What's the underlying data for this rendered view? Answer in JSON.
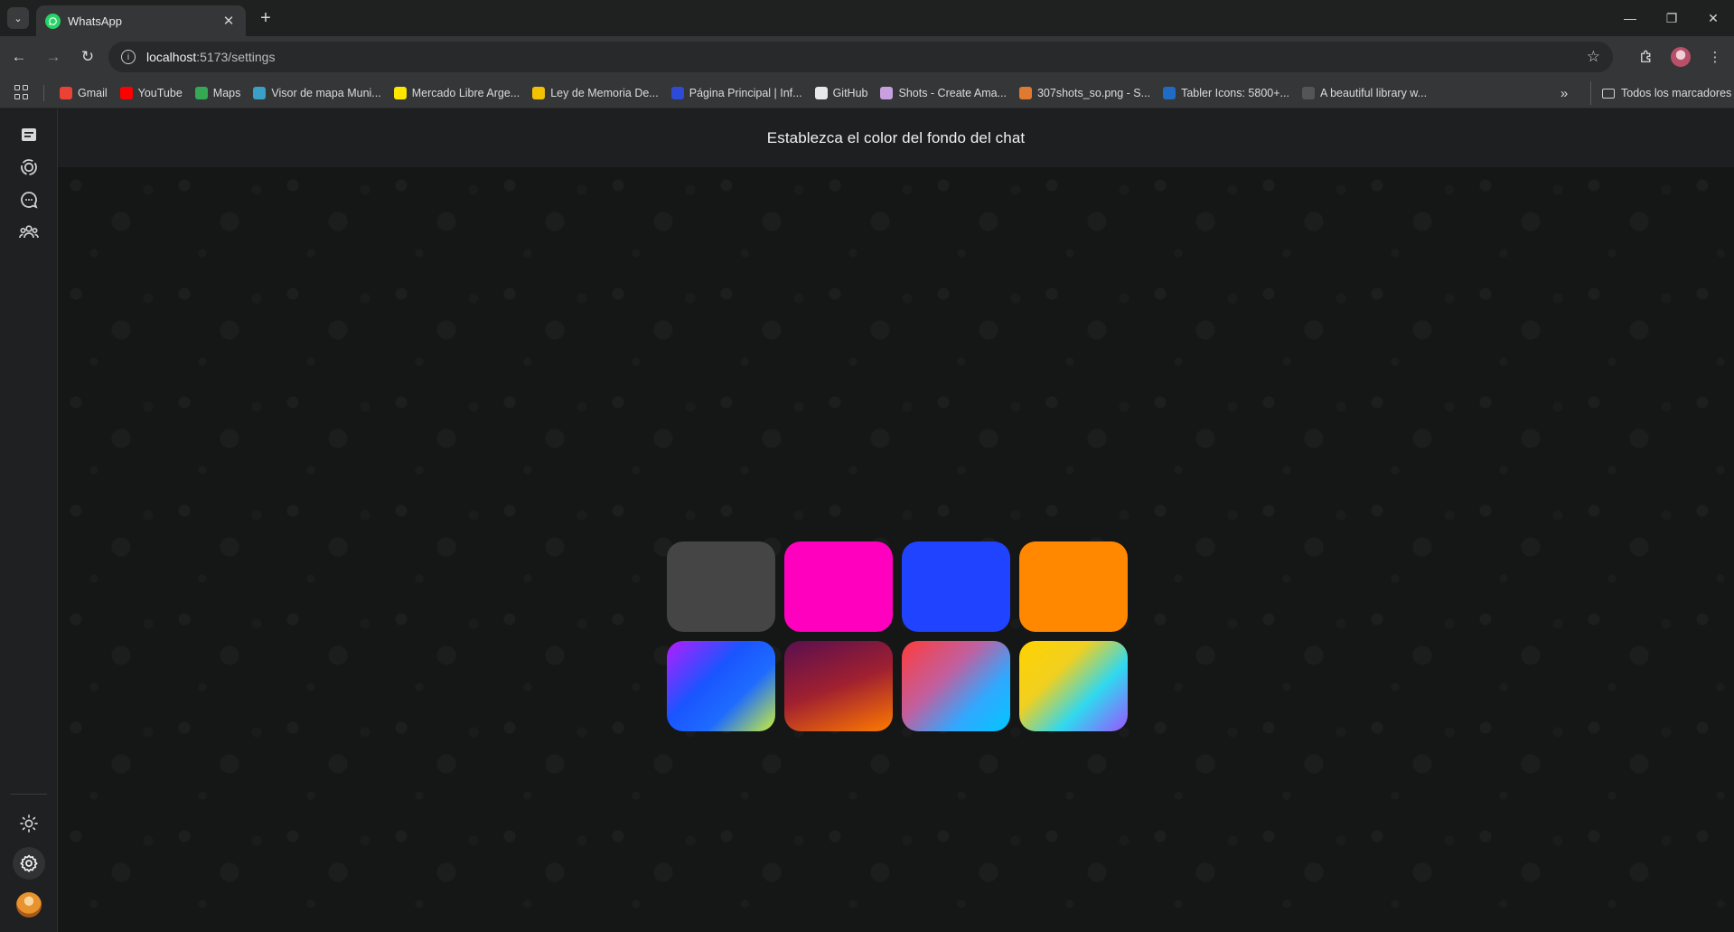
{
  "browser": {
    "tab_title": "WhatsApp",
    "url_host": "localhost",
    "url_rest": ":5173/settings",
    "bookmarks": [
      {
        "label": "Gmail",
        "color": "#ea4335"
      },
      {
        "label": "YouTube",
        "color": "#ff0000"
      },
      {
        "label": "Maps",
        "color": "#34a853"
      },
      {
        "label": "Visor de mapa Muni...",
        "color": "#3aa0c8"
      },
      {
        "label": "Mercado Libre Arge...",
        "color": "#ffe600"
      },
      {
        "label": "Ley de Memoria De...",
        "color": "#f2c200"
      },
      {
        "label": "Página Principal | Inf...",
        "color": "#2d4bd6"
      },
      {
        "label": "GitHub",
        "color": "#e8e8e8"
      },
      {
        "label": "Shots - Create Ama...",
        "color": "#c8a0e0"
      },
      {
        "label": "307shots_so.png - S...",
        "color": "#e07a30"
      },
      {
        "label": "Tabler Icons: 5800+...",
        "color": "#206bc4"
      },
      {
        "label": "A beautiful library w...",
        "color": "#555555"
      }
    ],
    "all_bookmarks_label": "Todos los marcadores"
  },
  "app": {
    "header_title": "Establezca el color del fondo del chat",
    "sidebar_icons": [
      "chats-icon",
      "status-icon",
      "channels-icon",
      "communities-icon",
      "theme-icon",
      "settings-icon"
    ],
    "swatches": [
      {
        "name": "gray",
        "fill": "#454545"
      },
      {
        "name": "magenta",
        "fill": "#ff00bf"
      },
      {
        "name": "blue",
        "fill": "#1f43ff"
      },
      {
        "name": "orange",
        "fill": "#ff8800"
      },
      {
        "name": "purple-blue-lime",
        "fill": "linear-gradient(135deg, #b51cff 0%, #1a55ff 40%, #1e6bff 65%, #c8f03a 100%)"
      },
      {
        "name": "plum-orange",
        "fill": "linear-gradient(160deg, #5a0f4f 0%, #a02030 50%, #ff7a00 100%)"
      },
      {
        "name": "coral-sky",
        "fill": "linear-gradient(135deg, #ff3b3b 0%, #c060a0 40%, #30a8ff 70%, #00c8ff 100%)"
      },
      {
        "name": "gold-cyan-violet",
        "fill": "linear-gradient(135deg, #ffd200 0%, #f0d020 35%, #30d8f0 65%, #9a55ff 100%)"
      }
    ]
  }
}
